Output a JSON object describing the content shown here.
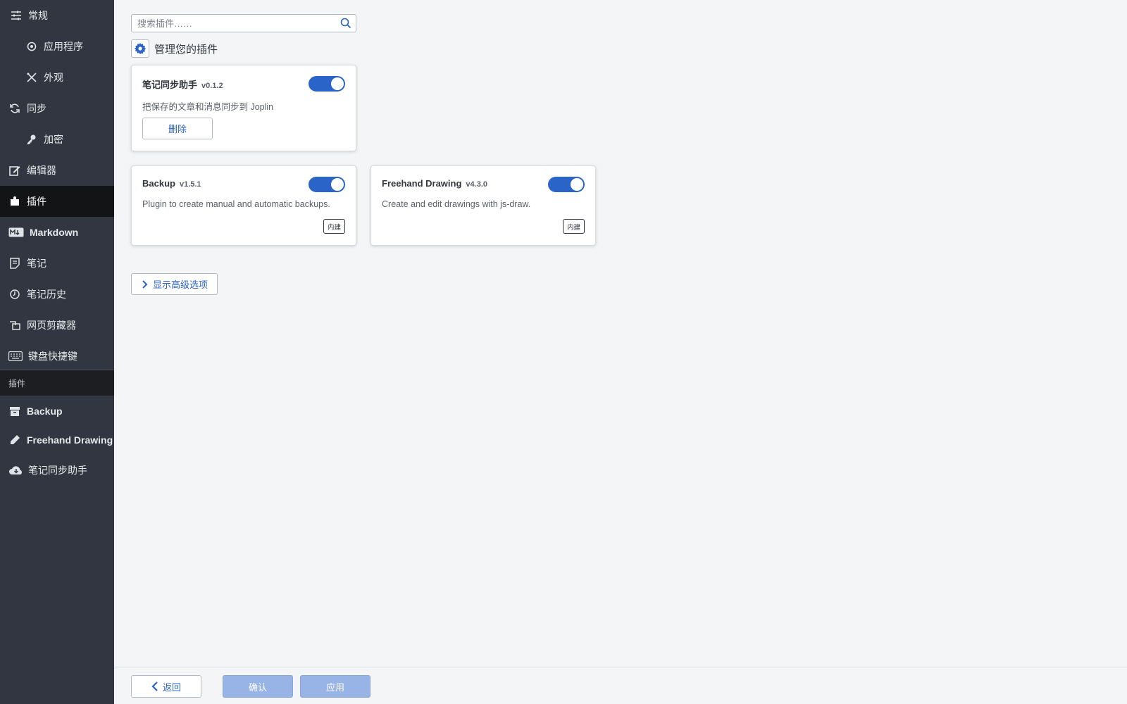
{
  "sidebar": {
    "items": [
      {
        "label": "常规",
        "icon": "sliders-icon"
      },
      {
        "label": "应用程序",
        "icon": "app-gear-icon"
      },
      {
        "label": "外观",
        "icon": "paint-tools-icon"
      },
      {
        "label": "同步",
        "icon": "sync-icon"
      },
      {
        "label": "加密",
        "icon": "key-icon"
      },
      {
        "label": "编辑器",
        "icon": "edit-icon"
      },
      {
        "label": "插件",
        "icon": "puzzle-icon"
      },
      {
        "label": "Markdown",
        "icon": "markdown-icon"
      },
      {
        "label": "笔记",
        "icon": "note-icon"
      },
      {
        "label": "笔记历史",
        "icon": "history-icon"
      },
      {
        "label": "网页剪藏器",
        "icon": "clipper-icon"
      },
      {
        "label": "键盘快捷键",
        "icon": "keyboard-icon"
      }
    ],
    "section_header": "插件",
    "plugin_items": [
      {
        "label": "Backup",
        "icon": "archive-icon"
      },
      {
        "label": "Freehand Drawing",
        "icon": "pen-icon"
      },
      {
        "label": "笔记同步助手",
        "icon": "cloud-download-icon"
      }
    ]
  },
  "search": {
    "placeholder": "搜索插件……"
  },
  "manage": {
    "label": "管理您的插件"
  },
  "plugins": [
    {
      "name": "笔记同步助手",
      "version": "v0.1.2",
      "description": "把保存的文章和消息同步到 Joplin",
      "enabled": true,
      "action_label": "删除"
    },
    {
      "name": "Backup",
      "version": "v1.5.1",
      "description": "Plugin to create manual and automatic backups.",
      "enabled": true,
      "badge": "内建"
    },
    {
      "name": "Freehand Drawing",
      "version": "v4.3.0",
      "description": "Create and edit drawings with js-draw.",
      "enabled": true,
      "badge": "内建"
    }
  ],
  "advanced": {
    "label": "显示高级选项"
  },
  "footer": {
    "back_label": "返回",
    "ok_label": "确认",
    "apply_label": "应用"
  },
  "colors": {
    "accent": "#2a64c8",
    "sidebar_bg": "#313640",
    "sidebar_active": "#131416",
    "disabled_button": "#98b3e6"
  }
}
